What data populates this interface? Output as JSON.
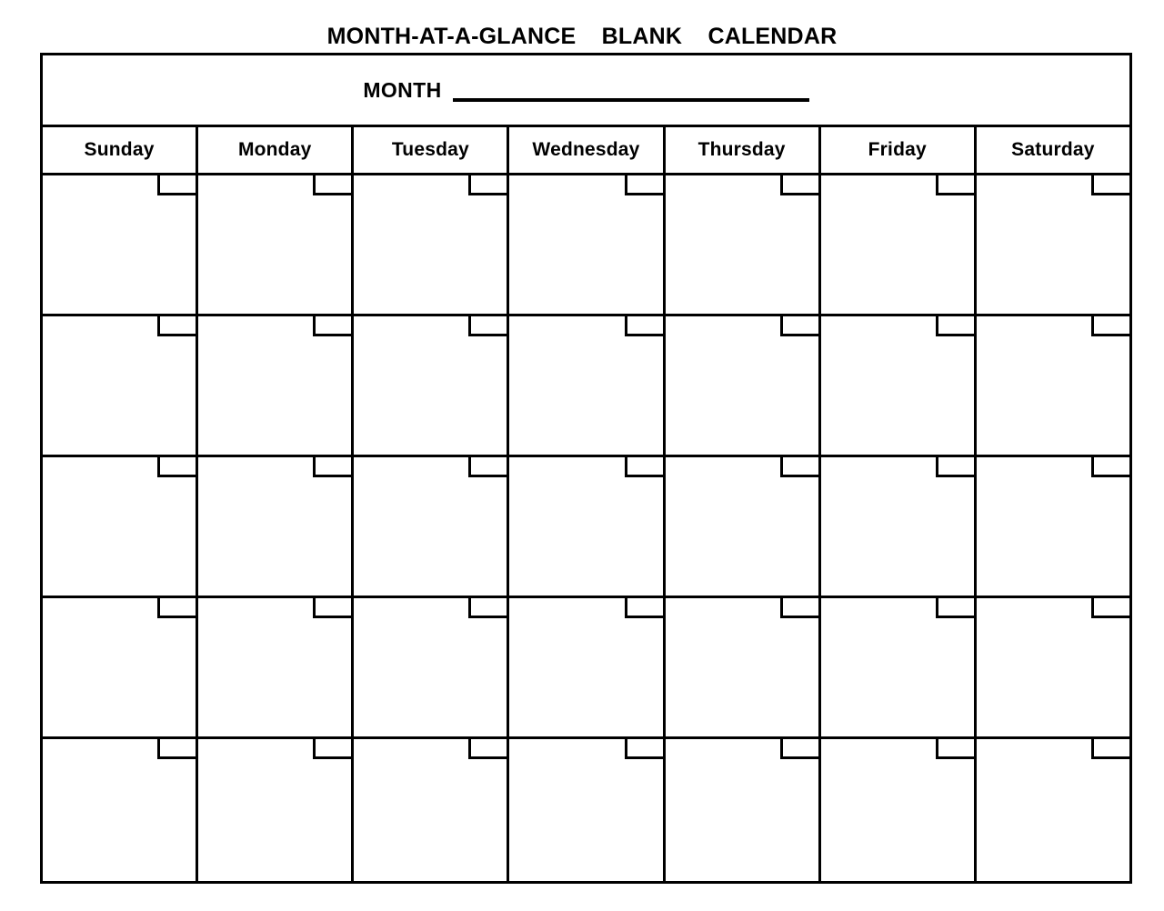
{
  "document": {
    "title": "MONTH-AT-A-GLANCE  BLANK  CALENDAR"
  },
  "month_row": {
    "label": "MONTH",
    "blank_line_value": "",
    "blank_line_placeholder": ""
  },
  "weekdays": [
    {
      "label": "Sunday"
    },
    {
      "label": "Monday"
    },
    {
      "label": "Tuesday"
    },
    {
      "label": "Wednesday"
    },
    {
      "label": "Thursday"
    },
    {
      "label": "Friday"
    },
    {
      "label": "Saturday"
    }
  ],
  "grid": {
    "rows": 5,
    "columns": 7,
    "cells": [
      [
        {
          "date": "",
          "note": ""
        },
        {
          "date": "",
          "note": ""
        },
        {
          "date": "",
          "note": ""
        },
        {
          "date": "",
          "note": ""
        },
        {
          "date": "",
          "note": ""
        },
        {
          "date": "",
          "note": ""
        },
        {
          "date": "",
          "note": ""
        }
      ],
      [
        {
          "date": "",
          "note": ""
        },
        {
          "date": "",
          "note": ""
        },
        {
          "date": "",
          "note": ""
        },
        {
          "date": "",
          "note": ""
        },
        {
          "date": "",
          "note": ""
        },
        {
          "date": "",
          "note": ""
        },
        {
          "date": "",
          "note": ""
        }
      ],
      [
        {
          "date": "",
          "note": ""
        },
        {
          "date": "",
          "note": ""
        },
        {
          "date": "",
          "note": ""
        },
        {
          "date": "",
          "note": ""
        },
        {
          "date": "",
          "note": ""
        },
        {
          "date": "",
          "note": ""
        },
        {
          "date": "",
          "note": ""
        }
      ],
      [
        {
          "date": "",
          "note": ""
        },
        {
          "date": "",
          "note": ""
        },
        {
          "date": "",
          "note": ""
        },
        {
          "date": "",
          "note": ""
        },
        {
          "date": "",
          "note": ""
        },
        {
          "date": "",
          "note": ""
        },
        {
          "date": "",
          "note": ""
        }
      ],
      [
        {
          "date": "",
          "note": ""
        },
        {
          "date": "",
          "note": ""
        },
        {
          "date": "",
          "note": ""
        },
        {
          "date": "",
          "note": ""
        },
        {
          "date": "",
          "note": ""
        },
        {
          "date": "",
          "note": ""
        },
        {
          "date": "",
          "note": ""
        }
      ]
    ]
  },
  "colors": {
    "ink": "#000000",
    "paper": "#ffffff"
  }
}
